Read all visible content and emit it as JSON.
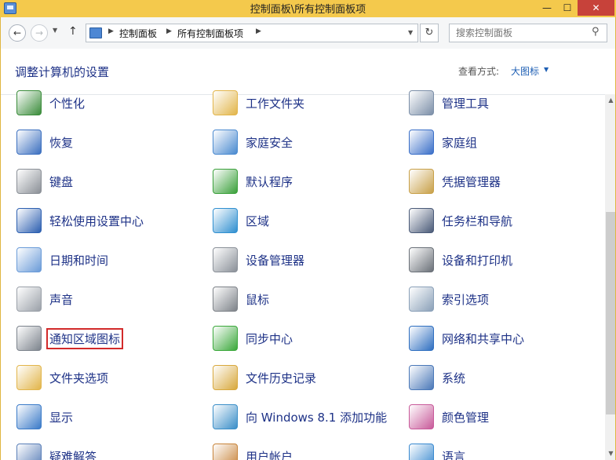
{
  "window": {
    "title": "控制面板\\所有控制面板项",
    "min_glyph": "—",
    "max_glyph": "☐",
    "close_glyph": "✕"
  },
  "nav": {
    "back_glyph": "←",
    "forward_glyph": "→",
    "dropdown_glyph": "▼",
    "up_glyph": "↑",
    "breadcrumbs": [
      "控制面板",
      "所有控制面板项"
    ],
    "sep_glyph": "▶",
    "refresh_glyph": "↻"
  },
  "search": {
    "placeholder": "搜索控制面板",
    "icon_glyph": "⚲"
  },
  "header": {
    "title": "调整计算机的设置",
    "view_by_label": "查看方式:",
    "view_by_value": "大图标",
    "view_caret": "▼"
  },
  "columns": [
    [
      {
        "label": "个性化",
        "icon": "personalization-icon",
        "color": "#3a8c3a"
      },
      {
        "label": "恢复",
        "icon": "recovery-icon",
        "color": "#3b6fbf"
      },
      {
        "label": "键盘",
        "icon": "keyboard-icon",
        "color": "#8a8f96"
      },
      {
        "label": "轻松使用设置中心",
        "icon": "ease-of-access-icon",
        "color": "#2c5fb0"
      },
      {
        "label": "日期和时间",
        "icon": "date-time-icon",
        "color": "#6a9bd8"
      },
      {
        "label": "声音",
        "icon": "sound-icon",
        "color": "#9aa0a8"
      },
      {
        "label": "通知区域图标",
        "icon": "notification-area-icon",
        "color": "#7c838c",
        "selected": true
      },
      {
        "label": "文件夹选项",
        "icon": "folder-options-icon",
        "color": "#e2b54a"
      },
      {
        "label": "显示",
        "icon": "display-icon",
        "color": "#3a7ac8"
      },
      {
        "label": "疑难解答",
        "icon": "troubleshooting-icon",
        "color": "#5a7fb8"
      }
    ],
    [
      {
        "label": "工作文件夹",
        "icon": "work-folders-icon",
        "color": "#e2b54a"
      },
      {
        "label": "家庭安全",
        "icon": "family-safety-icon",
        "color": "#4a8ad0"
      },
      {
        "label": "默认程序",
        "icon": "default-programs-icon",
        "color": "#3aa03a"
      },
      {
        "label": "区域",
        "icon": "region-icon",
        "color": "#2f8fd0"
      },
      {
        "label": "设备管理器",
        "icon": "device-manager-icon",
        "color": "#8a9098"
      },
      {
        "label": "鼠标",
        "icon": "mouse-icon",
        "color": "#7d8288"
      },
      {
        "label": "同步中心",
        "icon": "sync-center-icon",
        "color": "#3aa83a"
      },
      {
        "label": "文件历史记录",
        "icon": "file-history-icon",
        "color": "#d8a83c"
      },
      {
        "label": "向 Windows 8.1 添加功能",
        "icon": "add-features-icon",
        "color": "#3a8ec8"
      },
      {
        "label": "用户帐户",
        "icon": "user-accounts-icon",
        "color": "#c8843a"
      }
    ],
    [
      {
        "label": "管理工具",
        "icon": "administrative-tools-icon",
        "color": "#7c8fa8"
      },
      {
        "label": "家庭组",
        "icon": "homegroup-icon",
        "color": "#3a6fc8"
      },
      {
        "label": "凭据管理器",
        "icon": "credential-manager-icon",
        "color": "#c8a048"
      },
      {
        "label": "任务栏和导航",
        "icon": "taskbar-navigation-icon",
        "color": "#4a5a78"
      },
      {
        "label": "设备和打印机",
        "icon": "devices-printers-icon",
        "color": "#6a7078"
      },
      {
        "label": "索引选项",
        "icon": "indexing-options-icon",
        "color": "#8aa0b8"
      },
      {
        "label": "网络和共享中心",
        "icon": "network-sharing-icon",
        "color": "#2f6fc0"
      },
      {
        "label": "系统",
        "icon": "system-icon",
        "color": "#4a78b8"
      },
      {
        "label": "颜色管理",
        "icon": "color-management-icon",
        "color": "#c85a9a"
      },
      {
        "label": "语言",
        "icon": "language-icon",
        "color": "#3a8ad0"
      }
    ]
  ],
  "scrollbar": {
    "up_glyph": "▲",
    "down_glyph": "▼"
  }
}
